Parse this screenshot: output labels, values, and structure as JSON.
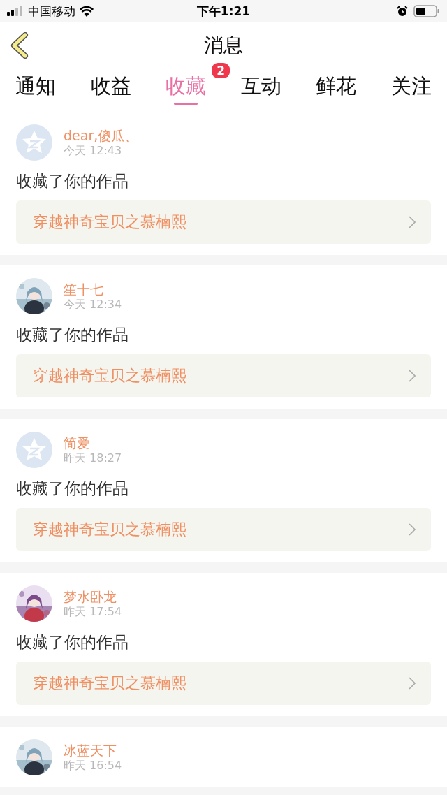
{
  "status_bar": {
    "carrier": "中国移动",
    "time": "下午1:21"
  },
  "nav": {
    "title": "消息"
  },
  "tabs": [
    {
      "label": "通知",
      "selected": false
    },
    {
      "label": "收益",
      "selected": false
    },
    {
      "label": "收藏",
      "selected": true,
      "badge": "2"
    },
    {
      "label": "互动",
      "selected": false
    },
    {
      "label": "鲜花",
      "selected": false
    },
    {
      "label": "关注",
      "selected": false
    }
  ],
  "messages": [
    {
      "name": "dear,傻瓜、",
      "time": "今天 12:43",
      "kind": "default",
      "action": "收藏了你的作品",
      "work": "穿越神奇宝贝之慕楠熙"
    },
    {
      "name": "笙十七",
      "time": "今天 12:34",
      "kind": "picture",
      "action": "收藏了你的作品",
      "work": "穿越神奇宝贝之慕楠熙"
    },
    {
      "name": "简爱",
      "time": "昨天 18:27",
      "kind": "default",
      "action": "收藏了你的作品",
      "work": "穿越神奇宝贝之慕楠熙"
    },
    {
      "name": "梦水卧龙",
      "time": "昨天 17:54",
      "kind": "picture",
      "action": "收藏了你的作品",
      "work": "穿越神奇宝贝之慕楠熙"
    },
    {
      "name": "冰蓝天下",
      "time": "昨天 16:54",
      "kind": "picture"
    }
  ]
}
